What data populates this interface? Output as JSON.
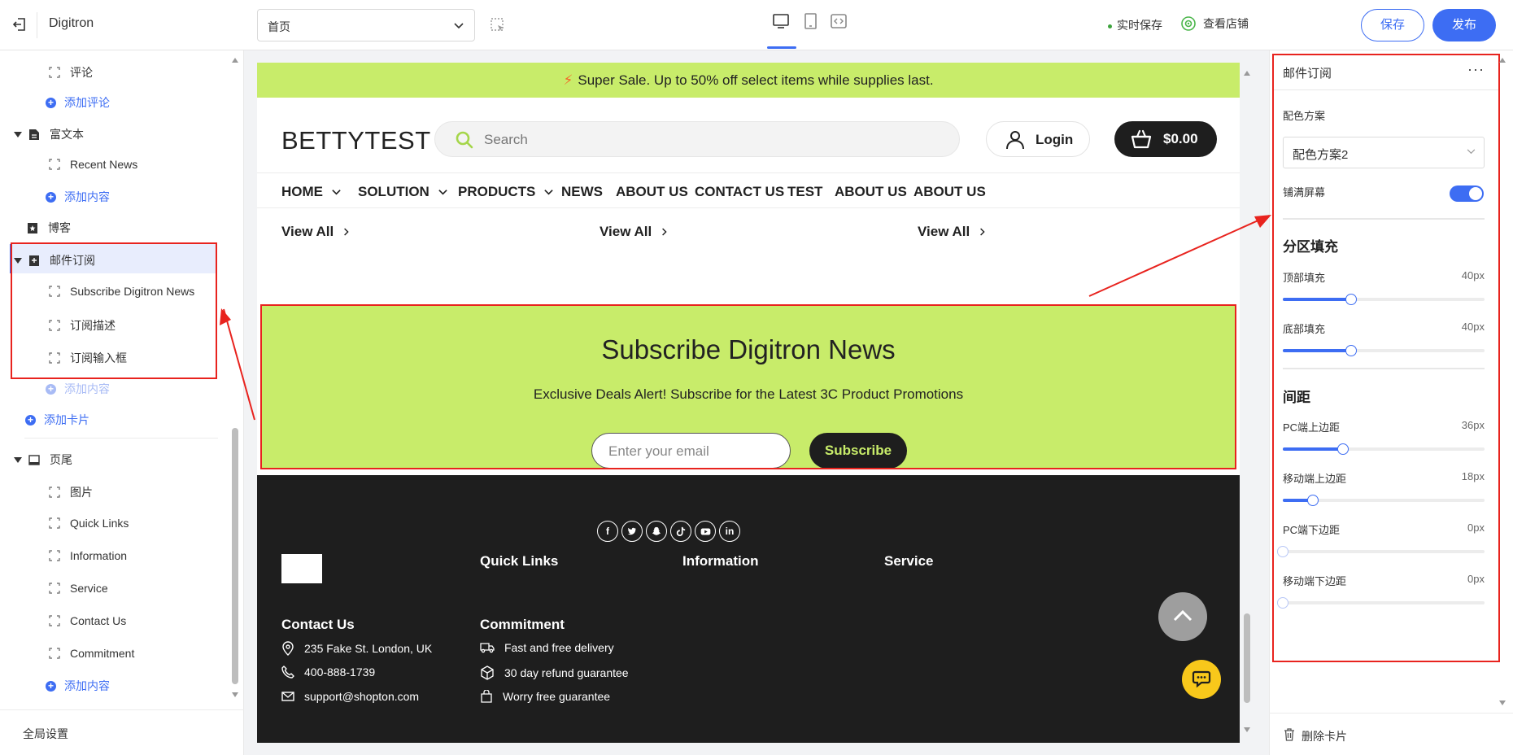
{
  "app": {
    "name": "Digitron"
  },
  "topbar": {
    "page_select": "首页",
    "autosave": "实时保存",
    "view_store": "查看店铺",
    "save": "保存",
    "publish": "发布"
  },
  "sidebar": {
    "items": [
      {
        "label": "评论"
      },
      {
        "label": "添加评论"
      },
      {
        "label": "富文本"
      },
      {
        "label": "Recent News"
      },
      {
        "label": "添加内容"
      },
      {
        "label": "博客"
      },
      {
        "label": "邮件订阅"
      },
      {
        "label": "Subscribe Digitron News"
      },
      {
        "label": "订阅描述"
      },
      {
        "label": "订阅输入框"
      },
      {
        "label": "添加内容"
      },
      {
        "label": "添加卡片"
      },
      {
        "label": "页尾"
      },
      {
        "label": "图片"
      },
      {
        "label": "Quick Links"
      },
      {
        "label": "Information"
      },
      {
        "label": "Service"
      },
      {
        "label": "Contact Us"
      },
      {
        "label": "Commitment"
      },
      {
        "label": "添加内容"
      }
    ],
    "footer": "全局设置"
  },
  "preview": {
    "promo": "Super Sale. Up to 50% off select items while supplies last.",
    "brand": "BETTYTEST",
    "search_placeholder": "Search",
    "login": "Login",
    "cart": "$0.00",
    "nav": [
      "HOME",
      "SOLUTION",
      "PRODUCTS",
      "NEWS",
      "ABOUT US",
      "CONTACT US",
      "TEST",
      "ABOUT US",
      "ABOUT US"
    ],
    "view_all": [
      "View All",
      "View All",
      "View All"
    ],
    "subscribe": {
      "title": "Subscribe Digitron News",
      "desc": "Exclusive Deals Alert! Subscribe for the Latest 3C Product Promotions",
      "placeholder": "Enter your email",
      "button": "Subscribe"
    },
    "footer": {
      "social": [
        "facebook",
        "twitter",
        "snapchat",
        "tiktok",
        "youtube",
        "linkedin"
      ],
      "headings": [
        "Quick Links",
        "Information",
        "Service",
        "Contact Us",
        "Commitment"
      ],
      "contact": [
        "235 Fake St. London, UK",
        "400-888-1739",
        "support@shopton.com"
      ],
      "commitment": [
        "Fast and free delivery",
        "30 day refund guarantee",
        "Worry free guarantee"
      ]
    }
  },
  "panel": {
    "title": "邮件订阅",
    "scheme_label": "配色方案",
    "scheme_value": "配色方案2",
    "fullscreen_label": "铺满屏幕",
    "fullscreen_on": true,
    "section_fill": "分区填充",
    "top_fill": {
      "label": "顶部填充",
      "value": "40px",
      "fraction": 0.34
    },
    "bottom_fill": {
      "label": "底部填充",
      "value": "40px",
      "fraction": 0.34
    },
    "spacing": "间距",
    "pc_top": {
      "label": "PC端上边距",
      "value": "36px",
      "fraction": 0.3
    },
    "mobile_top": {
      "label": "移动端上边距",
      "value": "18px",
      "fraction": 0.15
    },
    "pc_bottom": {
      "label": "PC端下边距",
      "value": "0px",
      "fraction": 0
    },
    "mobile_bottom": {
      "label": "移动端下边距",
      "value": "0px",
      "fraction": 0
    },
    "delete": "删除卡片"
  },
  "colors": {
    "accent": "#3d6df3",
    "promo": "#c8ec6a",
    "highlight": "#e8231e",
    "footer": "#1e1e1e"
  }
}
